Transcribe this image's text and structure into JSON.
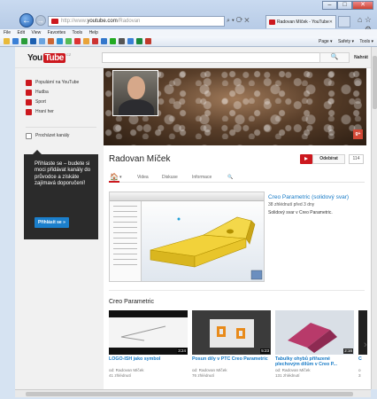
{
  "browser": {
    "url_prefix": "http://www.",
    "url_host": "youtube.com",
    "url_path": "/Radovan",
    "tab_title": "Radovan Míček - YouTube",
    "tab_close": "✕",
    "menu": [
      "File",
      "Edit",
      "View",
      "Favorites",
      "Tools",
      "Help"
    ],
    "command_bar": [
      "Page ▾",
      "Safety ▾",
      "Tools ▾"
    ],
    "address_icons": "⌕ ▾ ⟳ ✕",
    "window_controls": {
      "minimize": "–",
      "maximize": "□",
      "close": "✕"
    },
    "toolbar_icons": "⌂ ☆ ⚙",
    "back_icon": "←",
    "forward_icon": "→"
  },
  "youtube": {
    "logo_you": "You",
    "logo_tube": "Tube",
    "logo_region": "CZ",
    "search_button": "🔍",
    "login": "Nahrát"
  },
  "sidebar": {
    "items": [
      {
        "label": "Populární na YouTube",
        "icon": "youtube-icon"
      },
      {
        "label": "Hudba",
        "icon": "music-icon"
      },
      {
        "label": "Sport",
        "icon": "sport-icon"
      },
      {
        "label": "Hraní her",
        "icon": "gaming-icon"
      }
    ],
    "browse": "Procházet kanály",
    "tooltip_text": "Přihlaste se – budete si moci přidávat kanály do průvodce a získáte zajímavá doporučení!",
    "tooltip_button": "Přihlásit se »"
  },
  "channel": {
    "name": "Radovan Míček",
    "subscribe": "Odebírat",
    "subscriber_count": "114",
    "gplus": "g+",
    "tabs": {
      "home_icon": "🏠",
      "caret": "▾",
      "video": "Videa",
      "discussion": "Diskuse",
      "info": "Informace",
      "search": "🔍"
    }
  },
  "featured": {
    "title": "Creo Parametric (solidový svar)",
    "meta": "38 zhlédnutí  před 3 dny",
    "desc": "Solidový svar v Creo Parametric."
  },
  "shelf": {
    "title": "Creo Parametric",
    "videos": [
      {
        "title": "LOGO-ISH jako symbol",
        "by": "od: Radovan Míček",
        "views": "41 zhlédnutí",
        "duration": "3:24"
      },
      {
        "title": "Posun díly v PTC Creo Parametric",
        "by": "od: Radovan Míček",
        "views": "76 zhlédnutí",
        "duration": "5:23"
      },
      {
        "title": "Tabulky ohybů přiřazené plechovým dílům v Creo P...",
        "by": "od: Radovan Míček",
        "views": "131 zhlédnutí",
        "duration": "2:16"
      },
      {
        "title": "C",
        "by": "o",
        "views": "3",
        "duration": ""
      }
    ],
    "next_arrow": "›"
  }
}
